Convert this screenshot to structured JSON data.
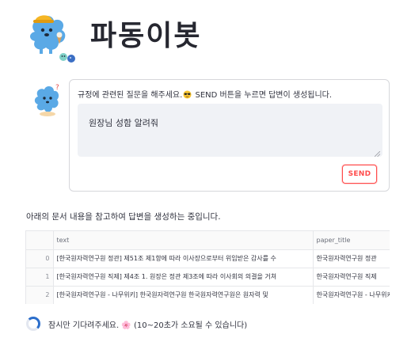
{
  "header": {
    "title": "파동이봇"
  },
  "form": {
    "label_before": "규정에 관련된 질문을 해주세요.",
    "label_after": " SEND 버튼을 누르면 답변이 생성됩니다.",
    "input_value": "원장님 성함 알려줘",
    "send_label": "SEND"
  },
  "status": {
    "text": "아래의 문서 내용을 참고하여 답변을 생성하는 중입니다."
  },
  "table": {
    "columns": [
      "",
      "text",
      "paper_title"
    ],
    "rows": [
      {
        "index": "0",
        "text": "[한국원자력연구원 정관] 제51조 제1항에 따라 이사장으로부터 위임받은 감사를 수",
        "paper_title": "한국원자력연구원 정관"
      },
      {
        "index": "1",
        "text": "[한국원자력연구원 직제] 제4조 1. 원장은 정관 제3조에 따라 이사회의 의결을 거쳐",
        "paper_title": "한국원자력연구원 직제"
      },
      {
        "index": "2",
        "text": "[한국원자력연구원 - 나무위키] 한국원자력연구원 한국원자력연구원은 원자력 및",
        "paper_title": "한국원자력연구원 - 나무위키"
      }
    ]
  },
  "spinner": {
    "text": "잠시만 기다려주세요. 🌸 (10~20초가 소요될 수 있습니다)"
  },
  "colors": {
    "accent": "#ff4b4b",
    "input_bg": "#f0f2f6",
    "spinner": "#2c6ecb",
    "mascot": "#5aa9e6"
  }
}
